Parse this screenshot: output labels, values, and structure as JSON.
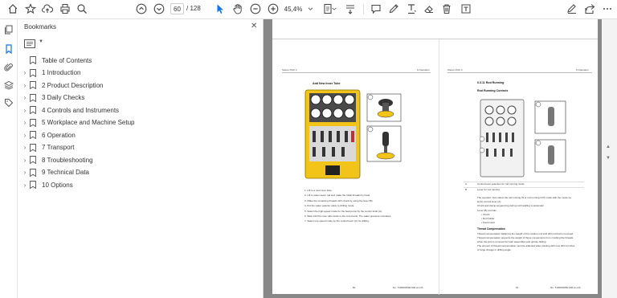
{
  "toolbar": {
    "current_page": "60",
    "total_pages": "/ 128",
    "zoom": "45,4%",
    "colors": {
      "accent": "#1473e6",
      "icon": "#4a4a4a"
    }
  },
  "panel": {
    "title": "Bookmarks",
    "items": [
      {
        "label": "Table of Contents",
        "expandable": false
      },
      {
        "label": "1 Introduction",
        "expandable": true
      },
      {
        "label": "2 Product Description",
        "expandable": true
      },
      {
        "label": "3 Daily Checks",
        "expandable": true
      },
      {
        "label": "4 Controls and Instruments",
        "expandable": true
      },
      {
        "label": "5 Workplace and Machine Setup",
        "expandable": true
      },
      {
        "label": "6 Operation",
        "expandable": true
      },
      {
        "label": "7 Transport",
        "expandable": true
      },
      {
        "label": "8 Troubleshooting",
        "expandable": true
      },
      {
        "label": "9 Technical Data",
        "expandable": true
      },
      {
        "label": "10 Options",
        "expandable": true
      }
    ]
  },
  "left_page": {
    "header_left": "Stereo PHC 4",
    "header_right": "6 Operation",
    "heading": "Add New Inner Tube",
    "steps": [
      "1.  Lift to a new inner tube.",
      "2.  Lift to water saver rod and make the initial threads by hand.",
      "3.  Make the remaining threads with chuck by using the lever (B).",
      "4.  Put the water selector valve to drilling mode.",
      "5.  Select the high-speed mode for the feed pump by the control knob (A).",
      "6.  Wait until the inner tube lands in the core barrel. The water pressure increases.",
      "7.  Select one speed mode by the control lever (C) for drilling."
    ],
    "footer_left": "60",
    "footer_right": "No. T100001550 000 en-US"
  },
  "right_page": {
    "header_left": "Stereo PHC 4",
    "header_right": "6 Operation",
    "section": "6.3.11 Rod Running",
    "subheading": "Rod Running Controls",
    "table_rows": [
      {
        "key": "A",
        "value": "Control lever selection for rod running mode"
      },
      {
        "key": "B",
        "value": "Lever for rod running"
      }
    ],
    "body": [
      "The operator must select the rod running IN or rod running OUT mode with the mode se-",
      "lector control lever (A).",
      "Chuck and clamp sequencing during rod handling is automatic.",
      "Lever (B) controls:",
      "•  Chuck",
      "•  Rod holder",
      "•  Feed travel"
    ],
    "thread_heading": "Thread Compensation",
    "thread_body": [
      "Thread compensation balances the weight of the rotation unit and drill rod that is removed.",
      "Thread compensation prevents the weight of these components from crushing the threads",
      "when the joint is removed for both assembles and uphole drilling.",
      "The amount of thread compensation must be adjusted when starting with new drill rod sizes",
      "or large change in drilling angle."
    ],
    "footer_left": "61",
    "footer_right": "No. T100001550 000 en-US"
  }
}
